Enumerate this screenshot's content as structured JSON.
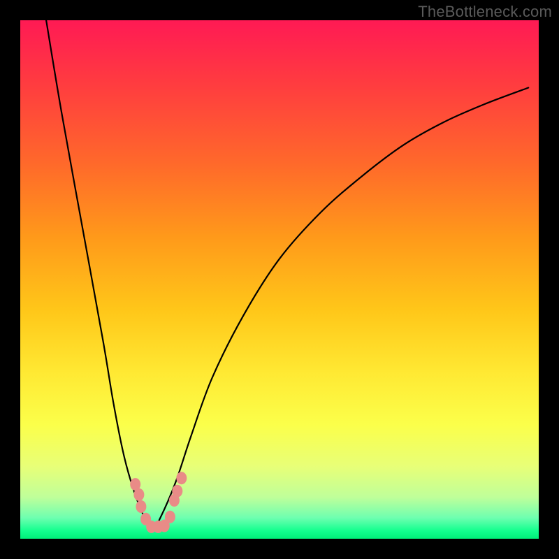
{
  "watermark": "TheBottleneck.com",
  "chart_data": {
    "type": "line",
    "title": "",
    "xlabel": "",
    "ylabel": "",
    "xlim": [
      0,
      100
    ],
    "ylim": [
      0,
      100
    ],
    "series": [
      {
        "name": "curve",
        "x": [
          5,
          8,
          12,
          16,
          18,
          20,
          22,
          24,
          25.5,
          27,
          30,
          33,
          37,
          43,
          50,
          58,
          66,
          74,
          82,
          90,
          98
        ],
        "y": [
          100,
          82,
          60,
          38,
          26,
          16,
          9,
          4,
          1.8,
          4,
          11,
          20,
          31,
          43,
          54,
          63,
          70,
          76,
          80.5,
          84,
          87
        ]
      }
    ],
    "markers": [
      {
        "x": 22.2,
        "y": 10.5
      },
      {
        "x": 22.9,
        "y": 8.5
      },
      {
        "x": 23.3,
        "y": 6.2
      },
      {
        "x": 24.2,
        "y": 3.8
      },
      {
        "x": 25.3,
        "y": 2.3
      },
      {
        "x": 26.6,
        "y": 2.3
      },
      {
        "x": 27.8,
        "y": 2.5
      },
      {
        "x": 28.9,
        "y": 4.2
      },
      {
        "x": 29.7,
        "y": 7.4
      },
      {
        "x": 30.3,
        "y": 9.2
      },
      {
        "x": 31.1,
        "y": 11.7
      }
    ],
    "gradient_stops": [
      {
        "pos": 0.0,
        "color": "#ff1a54"
      },
      {
        "pos": 0.5,
        "color": "#ffd21a"
      },
      {
        "pos": 0.85,
        "color": "#fbff4a"
      },
      {
        "pos": 1.0,
        "color": "#00f07a"
      }
    ]
  }
}
